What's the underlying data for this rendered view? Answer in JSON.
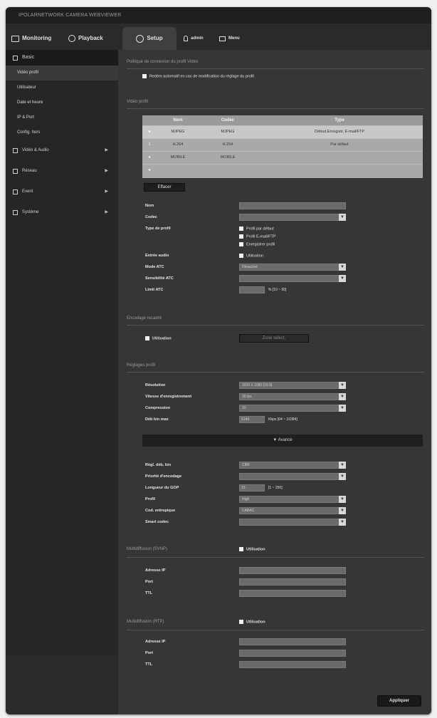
{
  "window": {
    "title": "IPOLARNETWORK CAMERA WEBVIEWER"
  },
  "nav": {
    "monitoring": "Monitoring",
    "playback": "Playback",
    "setup": "Setup",
    "user": "admin",
    "menu": "Menu"
  },
  "sidebar": {
    "basic": "Basic",
    "items": [
      "Vidéo profil",
      "Utilisateur",
      "Date et heure",
      "IP & Port",
      "Config. hors"
    ],
    "groups": [
      "Vidéo & Audio",
      "Réseau",
      "Event",
      "Système"
    ]
  },
  "sections": {
    "compat": "Politique de connexion du profil Vidéo",
    "compat_check": "Redém automatif en cas de modification du réglage du profil",
    "video_profile": "Vidéo profil",
    "crop": "Encodage recadré",
    "profile_settings": "Réglages profil",
    "multicast_svnp": "Multidiffusion (SVNP)",
    "multicast_rtp": "Multidiffusion (RTP)"
  },
  "profile_table": {
    "headers": [
      "Nom",
      "Codec",
      "Type"
    ],
    "rows": [
      [
        "",
        "MJPEG",
        "MJPEG",
        "Défaut,Enregistr, E-mail/FTP"
      ],
      [
        "1",
        "H.264",
        "H.264",
        "Par défaut"
      ],
      [
        "",
        "MOBILE",
        "MOBILE",
        ""
      ],
      [
        "",
        "",
        "",
        ""
      ]
    ]
  },
  "buttons": {
    "delete": "Effacer",
    "crop_area": "Zone sélect.",
    "advanced": "▼ Avancé",
    "apply": "Appliquer"
  },
  "form": {
    "name_label": "Nom",
    "codec_label": "Codec",
    "profile_type_label": "Type de profil",
    "profile_type_options": [
      "Profil par défaut",
      "Profil E-mail/FTP",
      "Enregistrer profil"
    ],
    "audio_label": "Entrée audio",
    "audio_check": "Utilisation",
    "atc_mode_label": "Mode ATC",
    "atc_mode_value": "Désactivé",
    "atc_sens_label": "Sensibilité ATC",
    "atc_limit_label": "Limit ATC",
    "atc_limit_hint": "% [10 ~ 50]",
    "crop_use": "Utilisation",
    "resolution_label": "Résolution",
    "resolution_value": "1920 X 1080 [16:9]",
    "framerate_label": "Vitesse d'enregistrement",
    "framerate_value": "30 fps",
    "compression_label": "Compression",
    "compression_value": "10",
    "maxbitrate_label": "Déb bin max",
    "maxbitrate_value": "6144",
    "maxbitrate_hint": "Kbps [64 ~ 16384]",
    "bitrate_ctrl_label": "Régl. déb. bin",
    "bitrate_ctrl_value": "CBR",
    "priority_label": "Priorité d'encodage",
    "gov_label": "Longueur du GOP",
    "gov_value": "15",
    "gov_hint": "[1 ~ 250]",
    "profile_label": "Profil",
    "profile_value": "High",
    "entropy_label": "Cod. entropique",
    "entropy_value": "CABAC",
    "smart_codec_label": "Smart codec",
    "multicast_use": "Utilisation",
    "ip_label": "Adresse IP",
    "port_label": "Port",
    "ttl_label": "TTL"
  }
}
